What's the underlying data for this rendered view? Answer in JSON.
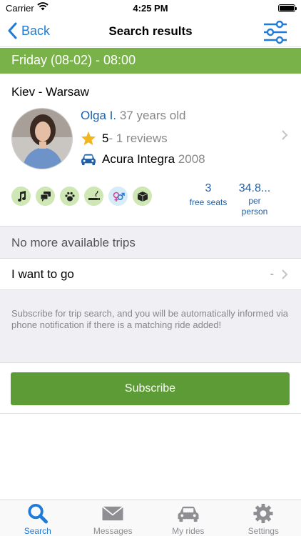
{
  "status": {
    "carrier": "Carrier",
    "time": "4:25 PM"
  },
  "nav": {
    "back_label": "Back",
    "title": "Search results"
  },
  "date_band": "Friday (08-02) - 08:00",
  "trip": {
    "route": "Kiev - Warsaw",
    "driver_name": "Olga I.",
    "driver_age": "37 years old",
    "rating": "5",
    "reviews": "- 1 reviews",
    "car_model": "Acura Integra",
    "car_year": "2008",
    "amenities": [
      "music-icon",
      "chat-icon",
      "pets-icon",
      "smoking-icon",
      "gender-icon",
      "luggage-icon"
    ],
    "seats_count": "3",
    "seats_label": "free seats",
    "price": "34.8...",
    "price_label_1": "per",
    "price_label_2": "person"
  },
  "no_more": "No more available trips",
  "want": {
    "label": "I want to go",
    "value": "-"
  },
  "hint": "Subscribe for trip search, and you will be automatically informed via phone notification if there is a matching ride added!",
  "subscribe_label": "Subscribe",
  "tabs": [
    {
      "label": "Search",
      "icon": "search-icon"
    },
    {
      "label": "Messages",
      "icon": "envelope-icon"
    },
    {
      "label": "My rides",
      "icon": "car-icon"
    },
    {
      "label": "Settings",
      "icon": "gear-icon"
    }
  ],
  "colors": {
    "accent": "#1f7ad8",
    "band": "#7ab24a",
    "button": "#5c9b35",
    "amenity_bg": "#cfe6b5"
  }
}
